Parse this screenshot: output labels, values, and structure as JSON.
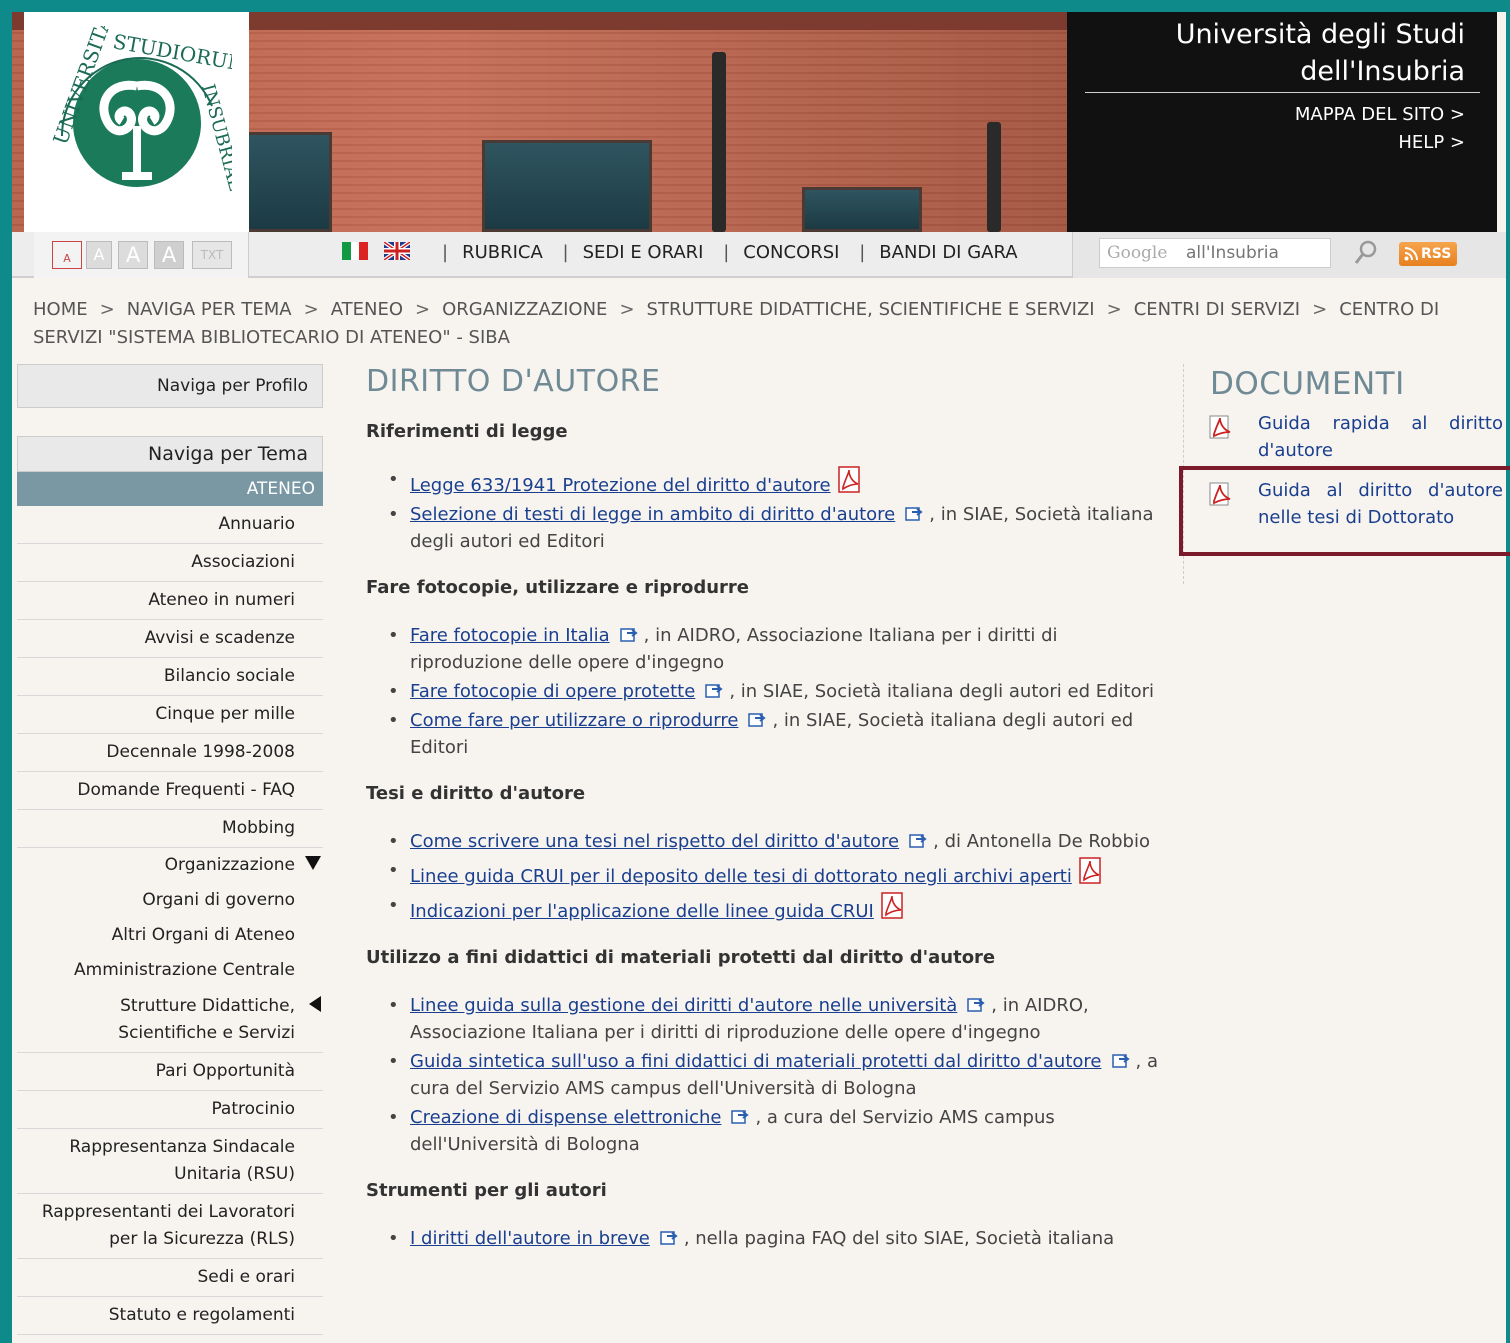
{
  "header": {
    "title_line1": "Università degli Studi",
    "title_line2": "dell'Insubria",
    "mappa": "MAPPA DEL SITO >",
    "help": "HELP >"
  },
  "toolbar": {
    "font_sizes": [
      "A",
      "A",
      "A",
      "A",
      "TXT"
    ],
    "nav": [
      "RUBRICA",
      "SEDI E ORARI",
      "CONCORSI",
      "BANDI DI GARA"
    ],
    "search_placeholder": "all'Insubria",
    "google": "Google",
    "rss": "RSS"
  },
  "breadcrumb": [
    "HOME",
    "NAVIGA PER TEMA",
    "ATENEO",
    "ORGANIZZAZIONE",
    "STRUTTURE DIDATTICHE, SCIENTIFICHE E SERVIZI",
    "CENTRI DI SERVIZI",
    "CENTRO DI SERVIZI \"SISTEMA BIBLIOTECARIO DI ATENEO\" - SIBA"
  ],
  "sidebar": {
    "profilo": "Naviga per Profilo",
    "tema": "Naviga per Tema",
    "active": "ATENEO",
    "items": [
      "Annuario",
      "Associazioni",
      "Ateneo in numeri",
      "Avvisi e scadenze",
      "Bilancio sociale",
      "Cinque per mille",
      "Decennale 1998-2008",
      "Domande Frequenti - FAQ",
      "Mobbing",
      "Organizzazione",
      "Organi di governo",
      "Altri Organi di Ateneo",
      "Amministrazione Centrale",
      "Strutture Didattiche, Scientifiche e Servizi",
      "Pari Opportunità",
      "Patrocinio",
      "Rappresentanza Sindacale Unitaria (RSU)",
      "Rappresentanti dei Lavoratori per la Sicurezza (RLS)",
      "Sedi e orari",
      "Statuto e regolamenti"
    ]
  },
  "main": {
    "title": "DIRITTO D'AUTORE",
    "sections": [
      {
        "title": "Riferimenti di legge",
        "items": [
          {
            "link": "Legge 633/1941 Protezione del diritto d'autore",
            "icon": "pdf",
            "rest": ""
          },
          {
            "link": "Selezione di testi di legge in ambito di diritto d'autore",
            "icon": "ext",
            "rest": ", in SIAE, Società italiana degli autori ed Editori"
          }
        ]
      },
      {
        "title": "Fare fotocopie, utilizzare e riprodurre",
        "items": [
          {
            "link": "Fare fotocopie in Italia",
            "icon": "ext",
            "rest": ", in AIDRO, Associazione Italiana per i diritti di riproduzione delle opere d'ingegno"
          },
          {
            "link": "Fare fotocopie di opere protette",
            "icon": "ext",
            "rest": ", in SIAE, Società italiana degli autori ed Editori"
          },
          {
            "link": "Come fare per utilizzare o riprodurre",
            "icon": "ext",
            "rest": ", in SIAE, Società italiana degli autori ed Editori"
          }
        ]
      },
      {
        "title": "Tesi e diritto d'autore",
        "items": [
          {
            "link": "Come scrivere una tesi nel rispetto del diritto d'autore",
            "icon": "ext",
            "rest": ", di Antonella De Robbio"
          },
          {
            "link": "Linee guida CRUI per il deposito delle tesi di dottorato negli archivi aperti",
            "icon": "pdf",
            "rest": ""
          },
          {
            "link": "Indicazioni per l'applicazione delle linee guida CRUI",
            "icon": "pdf",
            "rest": ""
          }
        ]
      },
      {
        "title": "Utilizzo a fini didattici di materiali protetti dal diritto d'autore",
        "items": [
          {
            "link": "Linee guida sulla gestione dei diritti d'autore nelle università",
            "icon": "ext",
            "rest": ", in AIDRO, Associazione Italiana per i diritti di riproduzione delle opere d'ingegno"
          },
          {
            "link": "Guida sintetica sull'uso a fini didattici di materiali protetti dal diritto d'autore",
            "icon": "ext",
            "rest": ", a cura del Servizio AMS campus dell'Università di Bologna"
          },
          {
            "link": "Creazione di dispense elettroniche",
            "icon": "ext",
            "rest": ", a cura del Servizio AMS campus dell'Università di Bologna"
          }
        ]
      },
      {
        "title": "Strumenti per gli autori",
        "items": [
          {
            "link": "I diritti dell'autore in breve",
            "icon": "ext",
            "rest": ", nella pagina FAQ del sito SIAE, Società italiana"
          }
        ]
      }
    ]
  },
  "documents": {
    "title": "DOCUMENTI",
    "items": [
      "Guida rapida al diritto d'autore",
      "Guida al diritto d'autore nelle tesi di Dottorato"
    ]
  },
  "colors": {
    "frame": "#0e8a8a",
    "heading": "#6f8a95",
    "link": "#1a3f8f",
    "active_nav": "#7a98a3",
    "highlight": "#7a1a2a"
  }
}
